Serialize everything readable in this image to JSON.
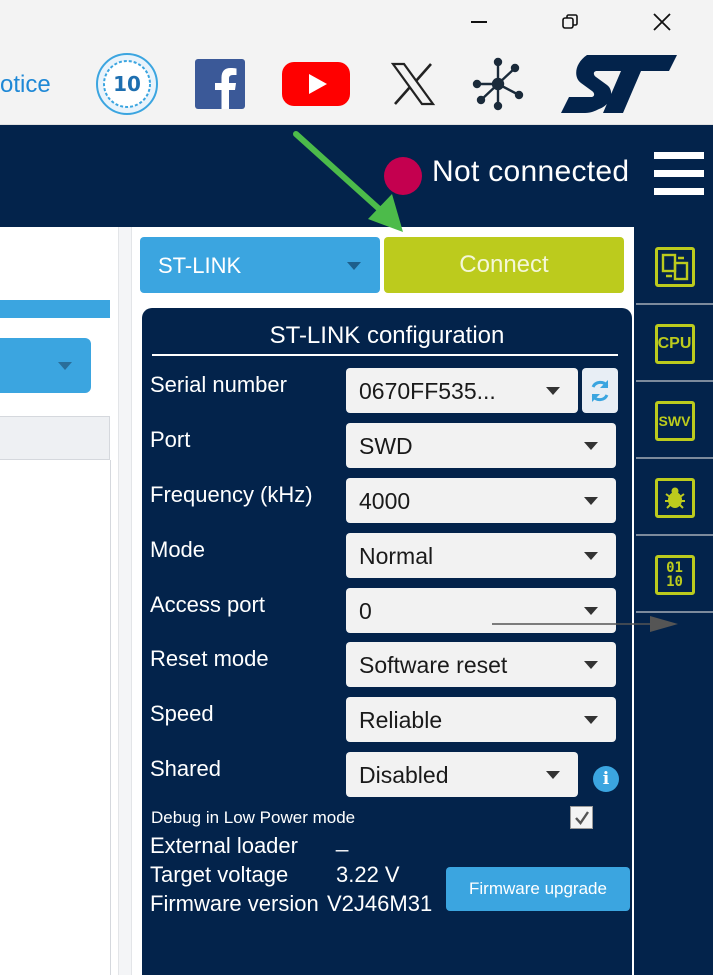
{
  "window": {
    "minimize_icon": "minimize-icon",
    "maximize_icon": "restore-icon",
    "close_icon": "close-icon"
  },
  "social": {
    "notice_text": "otice",
    "icons": [
      "anniversary-10-years-icon",
      "facebook-icon",
      "youtube-icon",
      "x-icon",
      "network-icon",
      "st-logo"
    ],
    "anniversary_text": "10"
  },
  "status": {
    "text": "Not connected",
    "dot_color": "#c4004f"
  },
  "probe": {
    "selected": "ST-LINK",
    "connect_label": "Connect"
  },
  "config": {
    "title": "ST-LINK configuration",
    "rows": [
      {
        "label": "Serial number",
        "value": "0670FF535..."
      },
      {
        "label": "Port",
        "value": "SWD"
      },
      {
        "label": "Frequency (kHz)",
        "value": "4000"
      },
      {
        "label": "Mode",
        "value": "Normal"
      },
      {
        "label": "Access port",
        "value": "0"
      },
      {
        "label": "Reset mode",
        "value": "Software reset"
      },
      {
        "label": "Speed",
        "value": "Reliable"
      },
      {
        "label": "Shared",
        "value": "Disabled"
      }
    ],
    "low_power_label": "Debug in Low Power mode",
    "low_power_checked": true,
    "external_loader_label": "External loader",
    "external_loader_value": "_",
    "target_voltage_label": "Target voltage",
    "target_voltage_value": "3.22 V",
    "firmware_version_label": "Firmware version",
    "firmware_version_value": "V2J46M31",
    "firmware_upgrade_label": "Firmware upgrade"
  },
  "sidebar": {
    "cpu_label": "CPU",
    "swv_label": "SWV",
    "binary_label_top": "01",
    "binary_label_bottom": "10"
  },
  "colors": {
    "navy": "#03234b",
    "accent_blue": "#3ba5e0",
    "connect_green": "#bccb1d",
    "annotation_arrow": "#4cbb4a"
  }
}
